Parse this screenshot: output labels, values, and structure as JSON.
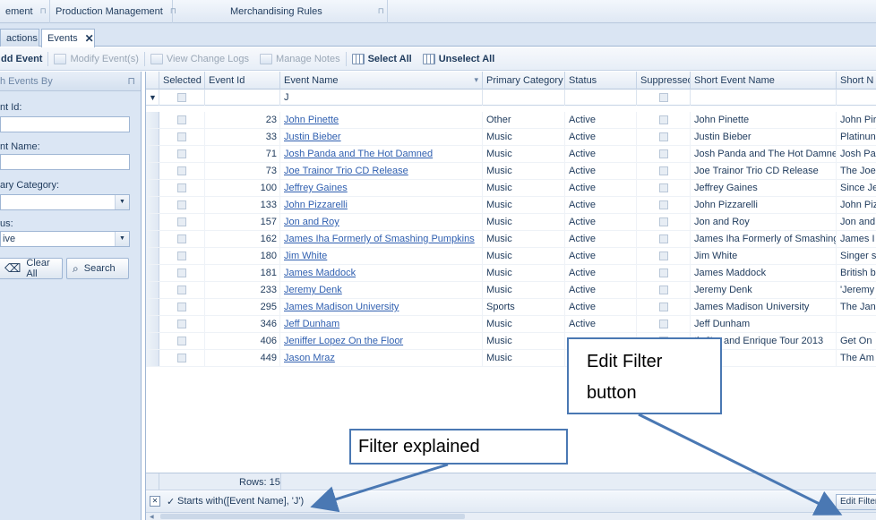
{
  "menubar": {
    "items": [
      {
        "label": "ement",
        "pin": "⊓"
      },
      {
        "label": "Production Management",
        "pin": "⊓"
      },
      {
        "label": "Merchandising Rules",
        "pin": "⊓"
      }
    ]
  },
  "tabs": [
    {
      "label": "actions"
    },
    {
      "label": "Events",
      "close": "✕"
    }
  ],
  "toolbar": {
    "add_event": "dd Event",
    "modify_event": "Modify Event(s)",
    "view_change_logs": "View Change Logs",
    "manage_notes": "Manage Notes",
    "select_all": "Select All",
    "unselect_all": "Unselect All"
  },
  "sidepanel": {
    "header": "h Events By",
    "pin": "⊓",
    "event_id_label": "nt Id:",
    "event_name_label": "nt Name:",
    "primary_category_label": "ary Category:",
    "status_label": "us:",
    "status_value": "ive",
    "clear_all": "Clear All",
    "search": "Search"
  },
  "grid": {
    "columns": [
      "Selected",
      "Event Id",
      "Event Name",
      "Primary Category",
      "Status",
      "Suppressed",
      "Short Event Name",
      "Short N"
    ],
    "filter_value": "J",
    "rows": [
      {
        "id": "23",
        "name": "John Pinette",
        "category": "Other",
        "status": "Active",
        "short": "John Pinette",
        "short2": "John Pir"
      },
      {
        "id": "33",
        "name": "Justin Bieber",
        "category": "Music",
        "status": "Active",
        "short": "Justin Bieber",
        "short2": "Platinun"
      },
      {
        "id": "71",
        "name": "Josh Panda and The Hot Damned",
        "category": "Music",
        "status": "Active",
        "short": "Josh Panda and The Hot Damned",
        "short2": "Josh Pa"
      },
      {
        "id": "73",
        "name": "Joe Trainor Trio CD Release",
        "category": "Music",
        "status": "Active",
        "short": "Joe Trainor Trio CD Release",
        "short2": "The Joe"
      },
      {
        "id": "100",
        "name": "Jeffrey Gaines",
        "category": "Music",
        "status": "Active",
        "short": "Jeffrey Gaines",
        "short2": "Since Je"
      },
      {
        "id": "133",
        "name": "John Pizzarelli",
        "category": "Music",
        "status": "Active",
        "short": "John Pizzarelli",
        "short2": "John Piz"
      },
      {
        "id": "157",
        "name": "Jon and Roy",
        "category": "Music",
        "status": "Active",
        "short": "Jon and Roy",
        "short2": "Jon and"
      },
      {
        "id": "162",
        "name": "James Iha Formerly of Smashing Pumpkins",
        "category": "Music",
        "status": "Active",
        "short": "James Iha Formerly of Smashing Pum...",
        "short2": "James I"
      },
      {
        "id": "180",
        "name": "Jim White",
        "category": "Music",
        "status": "Active",
        "short": "Jim White",
        "short2": "Singer s"
      },
      {
        "id": "181",
        "name": "James Maddock",
        "category": "Music",
        "status": "Active",
        "short": "James Maddock",
        "short2": "British b"
      },
      {
        "id": "233",
        "name": "Jeremy Denk",
        "category": "Music",
        "status": "Active",
        "short": "Jeremy Denk",
        "short2": "'Jeremy"
      },
      {
        "id": "295",
        "name": "James Madison University",
        "category": "Sports",
        "status": "Active",
        "short": "James Madison University",
        "short2": "The Jan"
      },
      {
        "id": "346",
        "name": "Jeff Dunham",
        "category": "Music",
        "status": "Active",
        "short": "Jeff Dunham",
        "short2": ""
      },
      {
        "id": "406",
        "name": "Jeniffer Lopez On the Floor",
        "category": "Music",
        "status": "",
        "short": "th JLo and Enrique Tour 2013",
        "short2": "Get On"
      },
      {
        "id": "449",
        "name": "Jason Mraz",
        "category": "Music",
        "status": "",
        "short": "az",
        "short2": "The Am"
      }
    ],
    "rows_count": "Rows: 15",
    "filter_expression": "Starts with([Event Name], 'J')",
    "filter_close": "✕",
    "filter_check": "✓",
    "edit_filter": "Edit Filter"
  },
  "annotations": {
    "edit_filter_callout_line1": "Edit Filter",
    "edit_filter_callout_line2": "button",
    "filter_explained": "Filter explained",
    "arrow_color": "#4a78b3"
  }
}
